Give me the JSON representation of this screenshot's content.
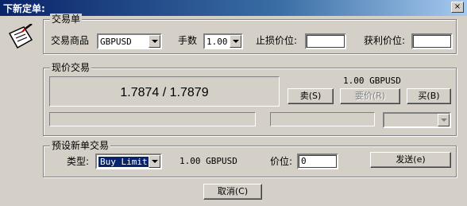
{
  "window": {
    "title": "下新定单:",
    "close_glyph": "×"
  },
  "order_group": {
    "legend": "交易单",
    "symbol_label": "交易商品",
    "symbol_value": "GBPUSD",
    "volume_label": "手数",
    "volume_value": "1.00",
    "stop_loss_label": "止损价位:",
    "stop_loss_value": "",
    "take_profit_label": "获利价位:",
    "take_profit_value": ""
  },
  "market_group": {
    "legend": "现价交易",
    "price_display": "1.7874 / 1.7879",
    "volume_info": "1.00 GBPUSD",
    "sell_label": "卖(S)",
    "request_label": "要价(R)",
    "buy_label": "买(B)"
  },
  "pending_group": {
    "legend": "预设新单交易",
    "type_label": "类型:",
    "type_value": "Buy Limit",
    "volume_info": "1.00 GBPUSD",
    "price_label": "价位:",
    "price_value": "0",
    "send_label": "发送(e)"
  },
  "cancel_label": "取消(C)",
  "colors": {
    "titlebar_start": "#0a246a",
    "titlebar_end": "#a6caf0",
    "face": "#d4d0c8",
    "selection": "#0a246a"
  }
}
